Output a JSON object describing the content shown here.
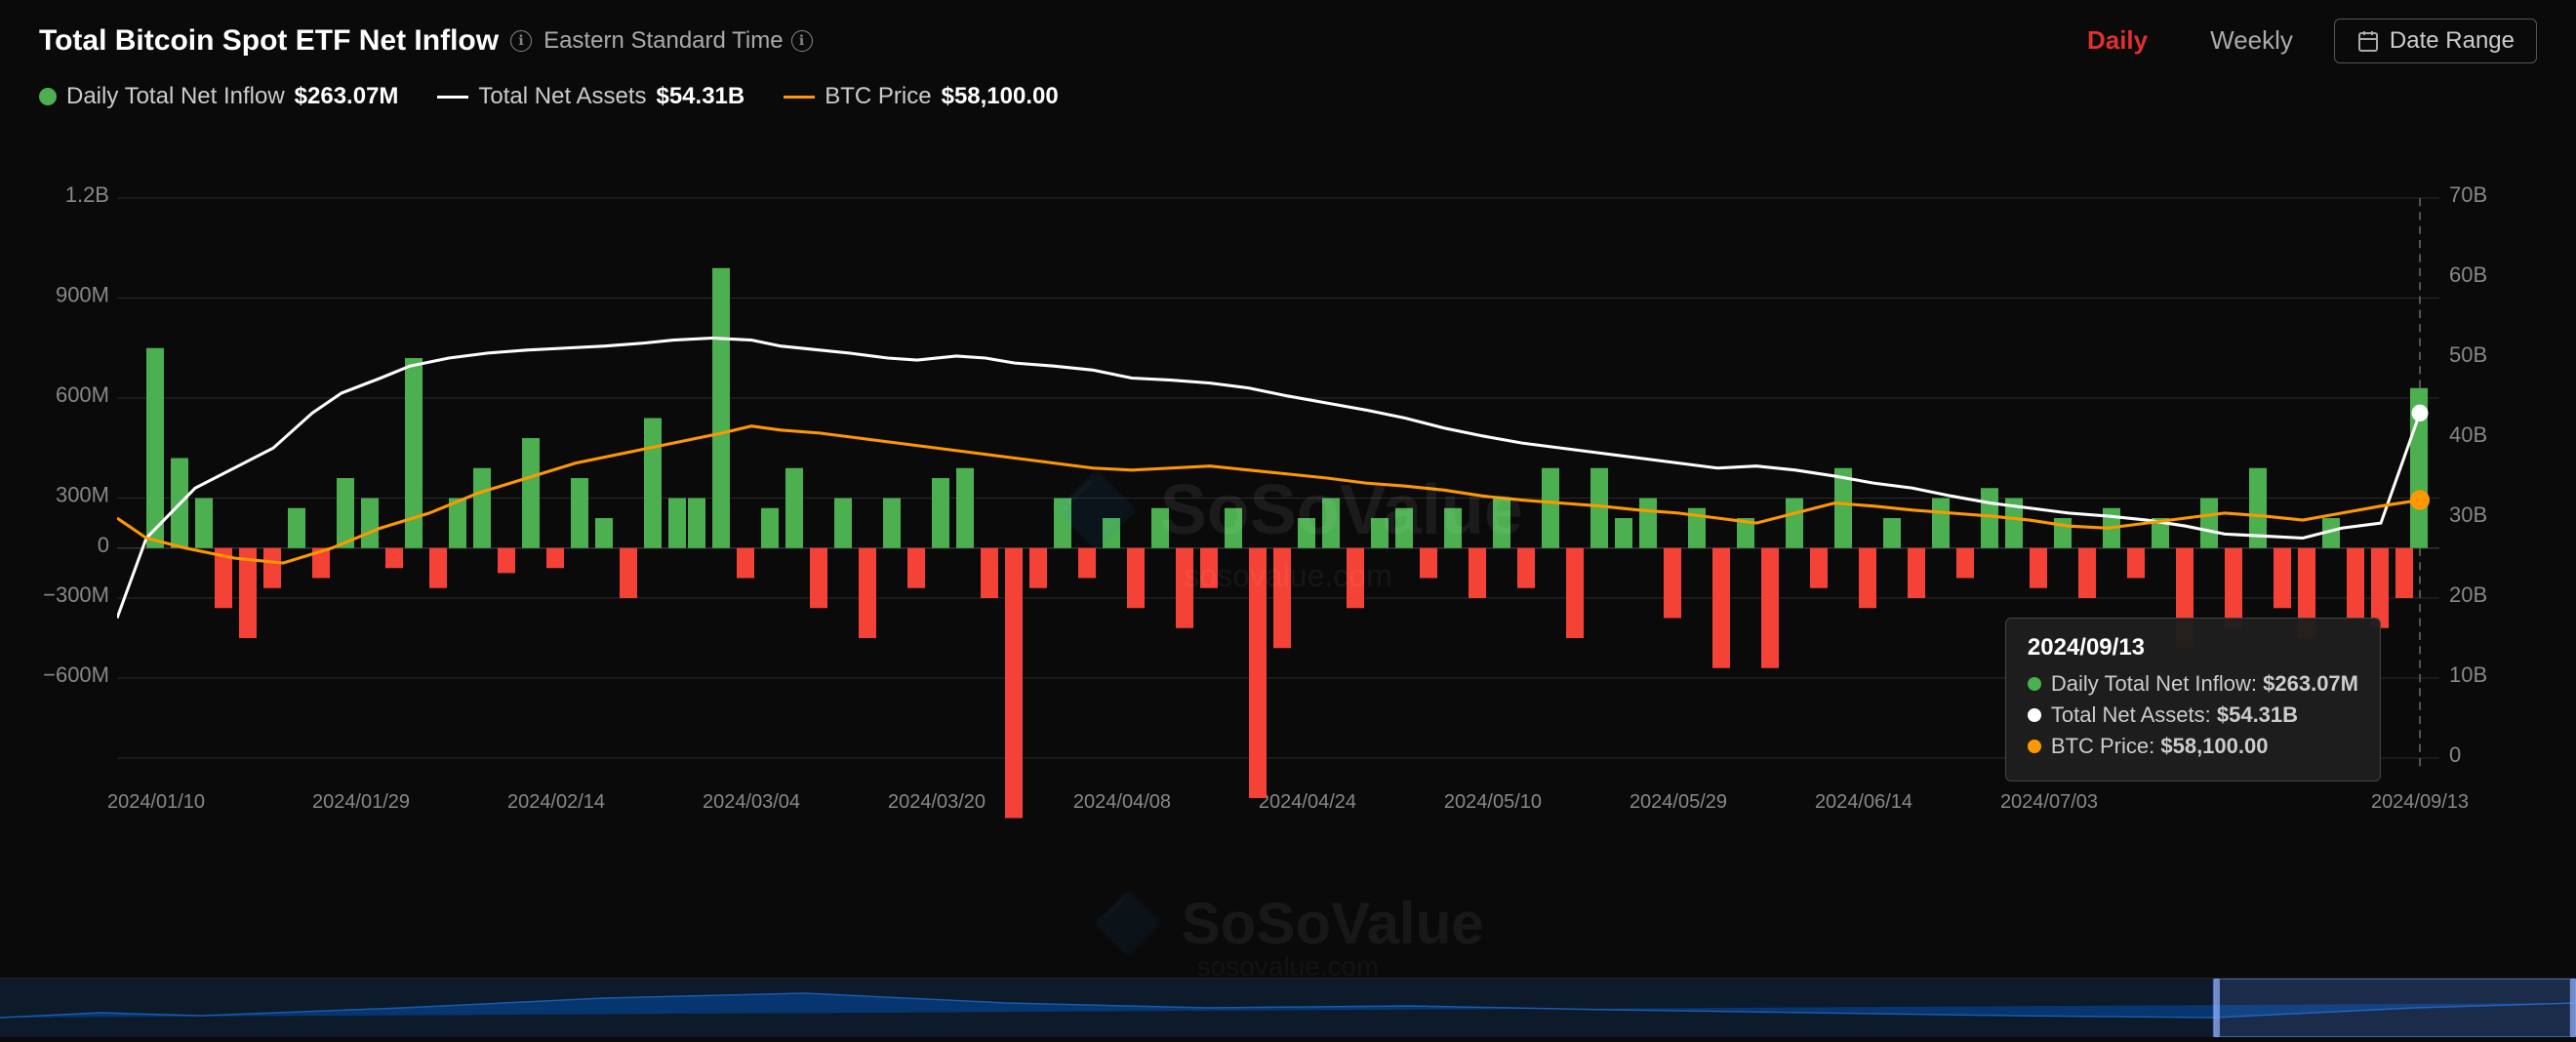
{
  "header": {
    "title": "Total Bitcoin Spot ETF Net Inflow",
    "timezone": "Eastern Standard Time",
    "info_icon": "ℹ",
    "timezone_info_icon": "ℹ"
  },
  "controls": {
    "daily_label": "Daily",
    "weekly_label": "Weekly",
    "date_range_label": "Date Range",
    "active_tab": "daily"
  },
  "legend": {
    "items": [
      {
        "type": "dot",
        "color": "#4caf50",
        "label": "Daily Total Net Inflow",
        "value": "$263.07M"
      },
      {
        "type": "line",
        "color": "#ffffff",
        "label": "Total Net Assets",
        "value": "$54.31B"
      },
      {
        "type": "line",
        "color": "#ff9800",
        "label": "BTC Price",
        "value": "$58,100.00"
      }
    ]
  },
  "chart": {
    "y_axis_left": [
      "1.2B",
      "900M",
      "600M",
      "300M",
      "0",
      "−300M",
      "−600M"
    ],
    "y_axis_right": [
      "70B",
      "60B",
      "50B",
      "40B",
      "30B",
      "20B",
      "10B",
      "0"
    ],
    "x_axis": [
      "2024/01/10",
      "2024/01/29",
      "2024/02/14",
      "2024/03/04",
      "2024/03/20",
      "2024/04/08",
      "2024/04/24",
      "2024/05/10",
      "2024/05/29",
      "2024/06/14",
      "2024/07/03",
      "2024/09/13"
    ],
    "accent_color": "#e03030",
    "green_bar_color": "#4caf50",
    "red_bar_color": "#f44336",
    "white_line_color": "#ffffff",
    "orange_line_color": "#ff9800"
  },
  "tooltip": {
    "date": "2024/09/13",
    "rows": [
      {
        "label": "Daily Total Net Inflow:",
        "value": "$263.07M",
        "color": "#4caf50"
      },
      {
        "label": "Total Net Assets:",
        "value": "$54.31B",
        "color": "#ffffff"
      },
      {
        "label": "BTC Price:",
        "value": "$58,100.00",
        "color": "#ff9800"
      }
    ]
  },
  "watermark": {
    "line1": "SoSoValue",
    "line2": "sosovalue.com"
  }
}
